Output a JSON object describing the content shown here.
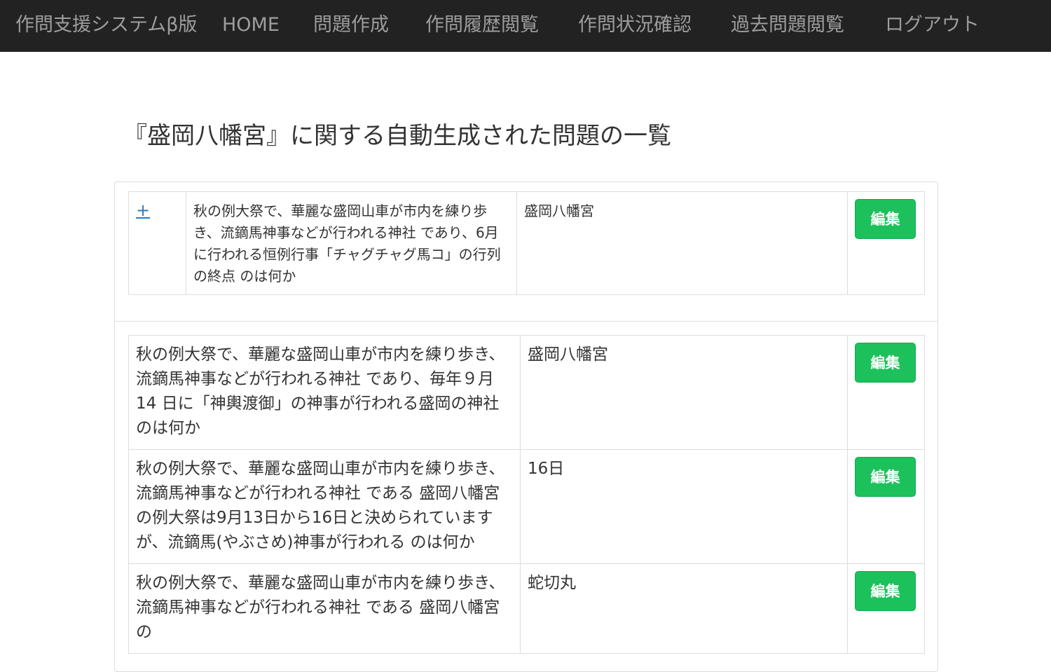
{
  "navbar": {
    "brand": "作問支援システムβ版",
    "items": [
      {
        "label": "HOME"
      },
      {
        "label": "問題作成"
      },
      {
        "label": "作問履歴閲覧"
      },
      {
        "label": "作問状況確認"
      },
      {
        "label": "過去問題閲覧"
      },
      {
        "label": "ログアウト"
      }
    ]
  },
  "page": {
    "title": "『盛岡八幡宮』に関する自動生成された問題の一覧"
  },
  "main_question": {
    "toggle": "+",
    "question": "秋の例大祭で、華麗な盛岡山車が市内を練り歩き、流鏑馬神事などが行われる神社 であり、6月に行われる恒例行事「チャグチャグ馬コ」の行列の終点 のは何か",
    "answer": "盛岡八幡宮",
    "edit_label": "編集"
  },
  "generated_questions": [
    {
      "question": "秋の例大祭で、華麗な盛岡山車が市内を練り歩き、流鏑馬神事などが行われる神社 であり、毎年９月 14 日に「神輿渡御」の神事が行われる盛岡の神社 のは何か",
      "answer": "盛岡八幡宮",
      "edit_label": "編集"
    },
    {
      "question": "秋の例大祭で、華麗な盛岡山車が市内を練り歩き、流鏑馬神事などが行われる神社 である 盛岡八幡宮 の例大祭は9月13日から16日と決められていますが、流鏑馬(やぶさめ)神事が行われる のは何か",
      "answer": "16日",
      "edit_label": "編集"
    },
    {
      "question": "秋の例大祭で、華麗な盛岡山車が市内を練り歩き、流鏑馬神事などが行われる神社 である 盛岡八幡宮 の",
      "answer": "蛇切丸",
      "edit_label": "編集"
    }
  ]
}
